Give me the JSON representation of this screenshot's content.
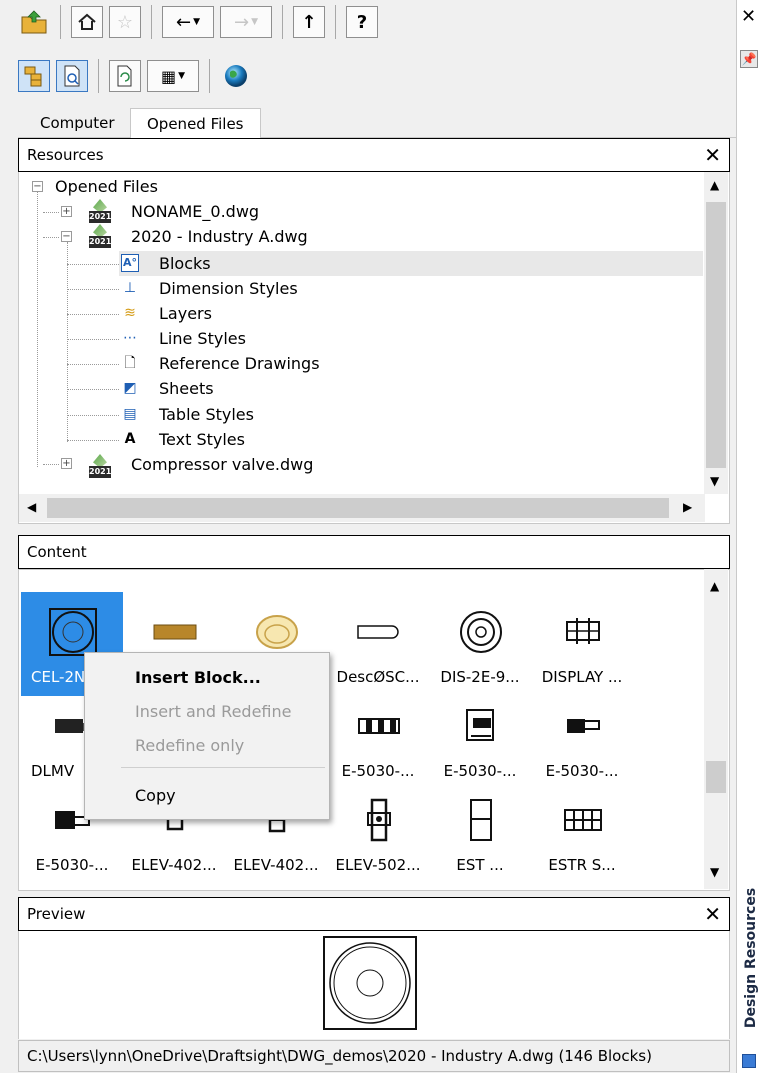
{
  "tabs": [
    {
      "label": "Computer"
    },
    {
      "label": "Opened Files"
    }
  ],
  "resources": {
    "title": "Resources",
    "tree": {
      "root": "Opened Files",
      "files": [
        {
          "name": "NONAME_0.dwg",
          "version": "2021"
        },
        {
          "name": "2020 - Industry A.dwg",
          "version": "2021"
        },
        {
          "name": "Compressor valve.dwg",
          "version": "2021"
        }
      ],
      "categories": [
        {
          "label": "Blocks",
          "icon": "blocks-icon"
        },
        {
          "label": "Dimension Styles",
          "icon": "dimension-styles-icon"
        },
        {
          "label": "Layers",
          "icon": "layers-icon"
        },
        {
          "label": "Line Styles",
          "icon": "line-styles-icon"
        },
        {
          "label": "Reference Drawings",
          "icon": "reference-drawings-icon"
        },
        {
          "label": "Sheets",
          "icon": "sheets-icon"
        },
        {
          "label": "Table Styles",
          "icon": "table-styles-icon"
        },
        {
          "label": "Text Styles",
          "icon": "text-styles-icon"
        }
      ]
    }
  },
  "content": {
    "title": "Content",
    "items": [
      {
        "label": "CEL-2N",
        "selected": true
      },
      {
        "label": ""
      },
      {
        "label": ""
      },
      {
        "label": "DescØSC..."
      },
      {
        "label": "DIS-2E-9..."
      },
      {
        "label": "DISPLAY ..."
      },
      {
        "label": "DLMV"
      },
      {
        "label": ""
      },
      {
        "label": ""
      },
      {
        "label": "E-5030-..."
      },
      {
        "label": "E-5030-..."
      },
      {
        "label": "E-5030-..."
      },
      {
        "label": "E-5030-..."
      },
      {
        "label": "ELEV-402..."
      },
      {
        "label": "ELEV-402..."
      },
      {
        "label": "ELEV-502..."
      },
      {
        "label": "EST ..."
      },
      {
        "label": "ESTR S..."
      }
    ]
  },
  "context_menu": {
    "items": [
      {
        "label": "Insert Block...",
        "state": "default"
      },
      {
        "label": "Insert and Redefine",
        "state": "disabled"
      },
      {
        "label": "Redefine only",
        "state": "disabled"
      },
      {
        "label": "Copy",
        "state": "enabled"
      }
    ]
  },
  "preview": {
    "title": "Preview"
  },
  "status_bar": {
    "text": "C:\\Users\\lynn\\OneDrive\\Draftsight\\DWG_demos\\2020 - Industry A.dwg (146 Blocks)"
  },
  "side_panel": {
    "title": "Design Resources"
  },
  "colors": {
    "selection": "#2d8ce6",
    "panel_border": "#000000",
    "tab_active_bg": "#ffffff"
  }
}
